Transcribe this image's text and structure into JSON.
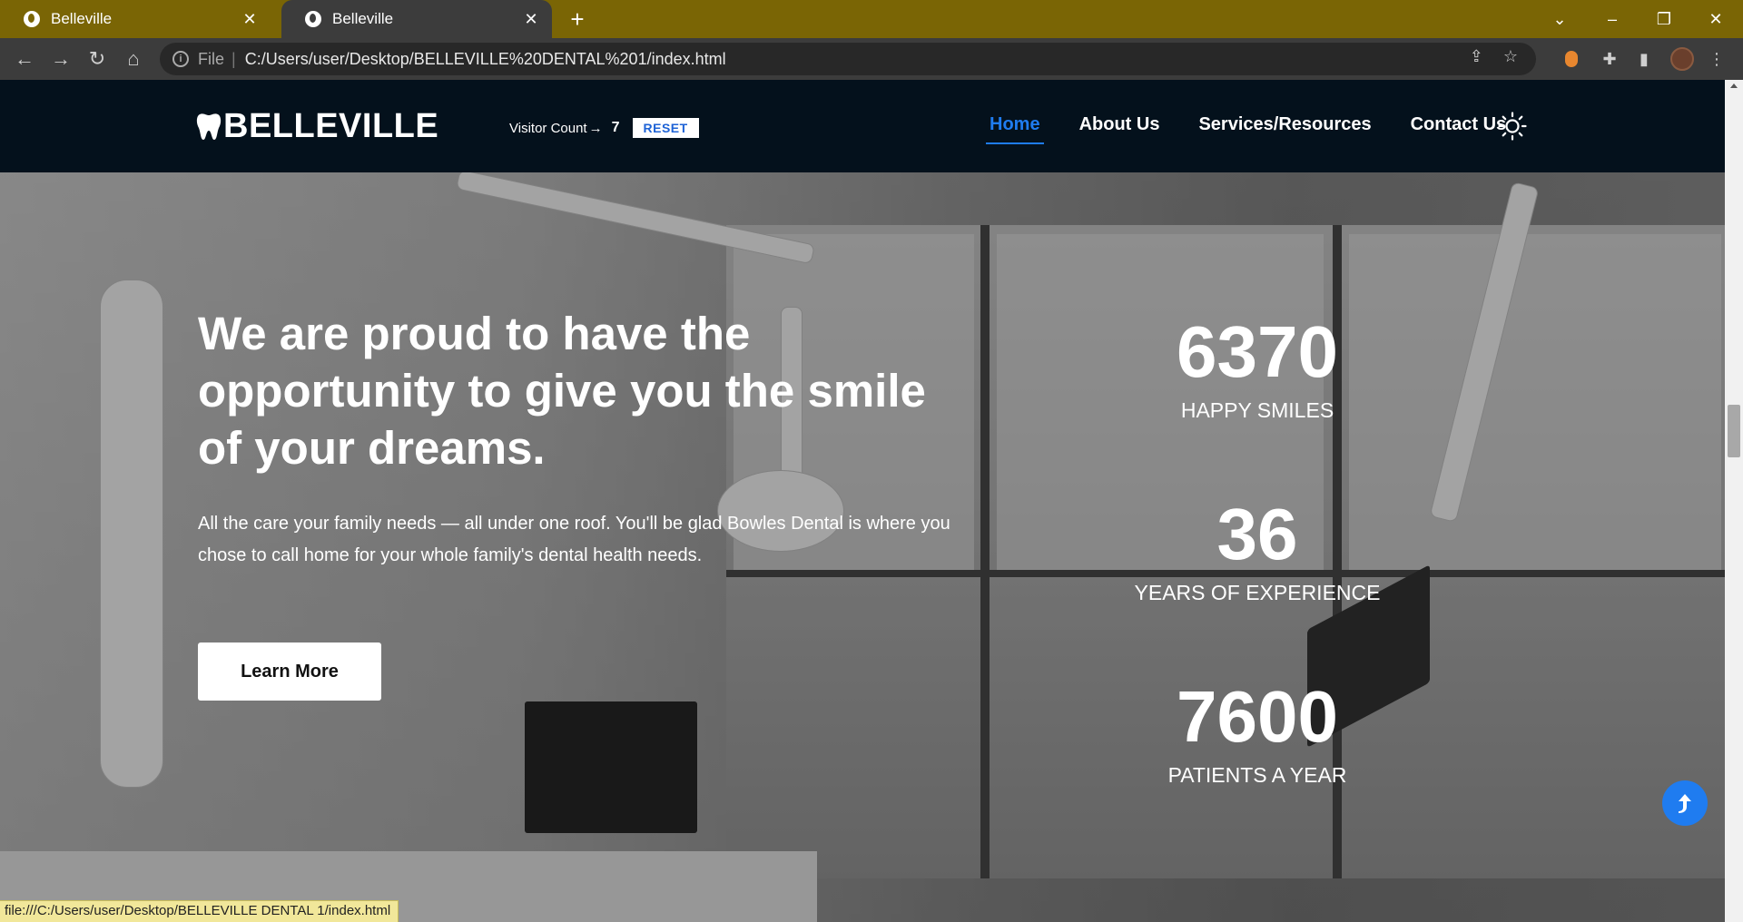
{
  "browser": {
    "tabs": [
      {
        "title": "Belleville",
        "active": false
      },
      {
        "title": "Belleville",
        "active": true
      }
    ],
    "new_tab_label": "+",
    "address": {
      "scheme_label": "File",
      "separator": "|",
      "url": "C:/Users/user/Desktop/BELLEVILLE%20DENTAL%201/index.html"
    },
    "status_url": "file:///C:/Users/user/Desktop/BELLEVILLE DENTAL 1/index.html"
  },
  "site": {
    "brand": "BELLEVILLE",
    "visitor": {
      "label": "Visitor Count",
      "arrow": "→",
      "count": "7",
      "reset_label": "RESET"
    },
    "nav": [
      {
        "label": "Home",
        "active": true
      },
      {
        "label": "About Us",
        "active": false
      },
      {
        "label": "Services/Resources",
        "active": false
      },
      {
        "label": "Contact Us",
        "active": false
      }
    ],
    "theme_toggle_icon": "sun-icon"
  },
  "hero": {
    "title": "We are proud to have the opportunity to give you the smile of your dreams.",
    "description": "All the care your family needs — all under one roof. You'll be glad Bowles Dental is where you chose to call home for your whole family's dental health needs.",
    "cta_label": "Learn More"
  },
  "stats": [
    {
      "value": "6370",
      "label": "HAPPY SMILES"
    },
    {
      "value": "36",
      "label": "YEARS OF EXPERIENCE"
    },
    {
      "value": "7600",
      "label": "PATIENTS A YEAR"
    }
  ],
  "colors": {
    "tabstrip": "#7a6505",
    "header_bg": "#04111c",
    "accent": "#1f7cf0",
    "reset_text": "#1e63d6"
  }
}
